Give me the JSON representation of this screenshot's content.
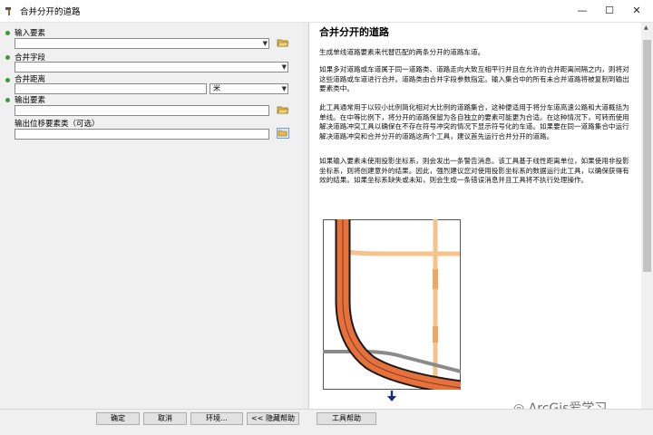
{
  "window": {
    "title": "合并分开的道路"
  },
  "params": {
    "input_label": "输入要素",
    "merge_field_label": "合并字段",
    "merge_distance_label": "合并距离",
    "unit_value": "米",
    "output_label": "输出要素",
    "displacement_label": "输出位移要素类（可选）"
  },
  "help": {
    "title": "合并分开的道路",
    "paragraphs": [
      "生成单线道路要素来代替匹配的两条分开的道路车道。",
      "如果多对道路或车道属于同一道路类、道路走向大致互相平行并且在允许的合并距离间隔之内，则将对这些道路或车道进行合并。道路类由合并字段参数指定。输入集合中的所有未合并道路将被复制到输出要素类中。",
      "此工具通常用于以较小比例简化相对大比例的道路集合，这种便适用于将分车道高速公路和大道概括为单线。在中等比例下，将分开的道路保留为各自独立的要素可能更为合适。在这种情况下，可转而使用解决道路冲突工具以确保在不存在符号冲突的情况下显示符号化的车道。如果要在同一道路集合中运行解决道路冲突和合并分开的道路这两个工具，建议首先运行合并分开的道路。",
      "如果输入要素未使用投影坐标系，则会发出一条警告消息。该工具基于线性距离单位，如果使用非投影坐标系，则将创建意外的结果。因此，强烈建议您对使用投影坐标系的数据运行此工具，以确保获得有效的结果。如果坐标系缺失或未知，则会生成一条错误消息并且工具将不执行处理操作。"
    ]
  },
  "buttons": {
    "ok": "确定",
    "cancel": "取消",
    "env": "环境...",
    "hide_help": "<< 隐藏帮助",
    "tool_help": "工具帮助"
  },
  "watermark": "ArcGis爱学习",
  "colors": {
    "road_fill": "#e8703a",
    "road_outline": "#1a1a1a",
    "minor_road": "#f6c28a",
    "required_dot": "#3a9a3a"
  }
}
